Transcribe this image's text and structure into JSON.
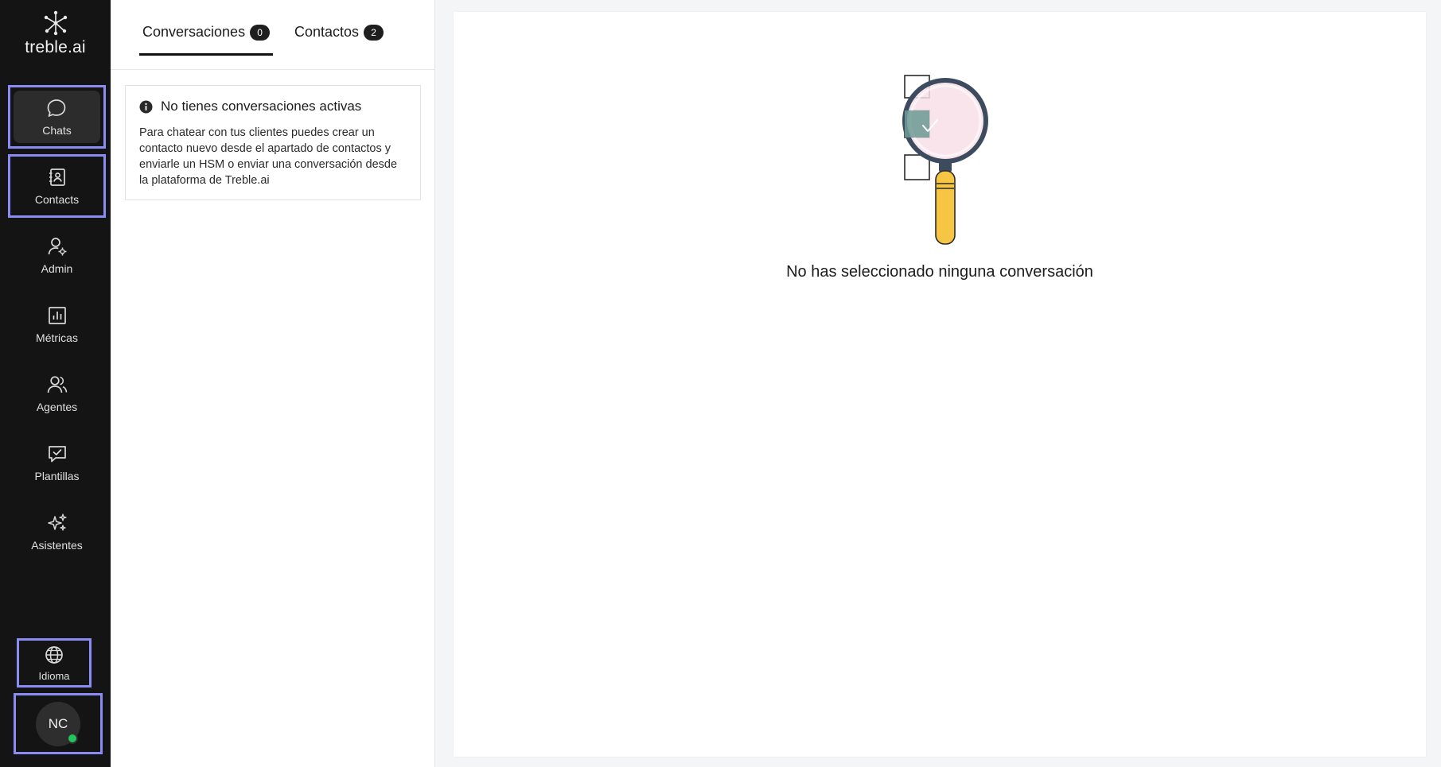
{
  "app": {
    "logo_text": "treble.ai",
    "colors": {
      "sidebar_bg": "#141414",
      "selection_outline": "#8b8bf5",
      "online_status": "#22c55e",
      "badge_bg": "#1e1e1e",
      "magnifier_handle": "#f6c544",
      "magnifier_frame": "#3d4b5e"
    }
  },
  "sidebar": {
    "items": [
      {
        "id": "chats",
        "label": "Chats",
        "icon": "chat-bubble-icon",
        "active": true
      },
      {
        "id": "contacts",
        "label": "Contacts",
        "icon": "contact-book-icon",
        "active": false
      },
      {
        "id": "admin",
        "label": "Admin",
        "icon": "user-gear-icon",
        "active": false
      },
      {
        "id": "metrics",
        "label": "Métricas",
        "icon": "bar-chart-icon",
        "active": false
      },
      {
        "id": "agents",
        "label": "Agentes",
        "icon": "users-icon",
        "active": false
      },
      {
        "id": "templates",
        "label": "Plantillas",
        "icon": "message-check-icon",
        "active": false
      },
      {
        "id": "assistants",
        "label": "Asistentes",
        "icon": "sparkles-icon",
        "active": false
      }
    ],
    "language": {
      "label": "Idioma",
      "icon": "globe-icon"
    },
    "user": {
      "initials": "NC",
      "status": "online"
    }
  },
  "conversations_panel": {
    "tabs": [
      {
        "label": "Conversaciones",
        "count": "0",
        "selected": true
      },
      {
        "label": "Contactos",
        "count": "2",
        "selected": false
      }
    ],
    "info": {
      "title": "No tienes conversaciones activas",
      "body": "Para chatear con tus clientes puedes crear un contacto nuevo desde el apartado de contactos y enviarle un HSM o enviar una conversación desde la plataforma de Treble.ai",
      "icon": "info-icon"
    }
  },
  "main": {
    "empty_message": "No has seleccionado ninguna conversación",
    "illustration": "magnifier-checklist-illustration"
  }
}
